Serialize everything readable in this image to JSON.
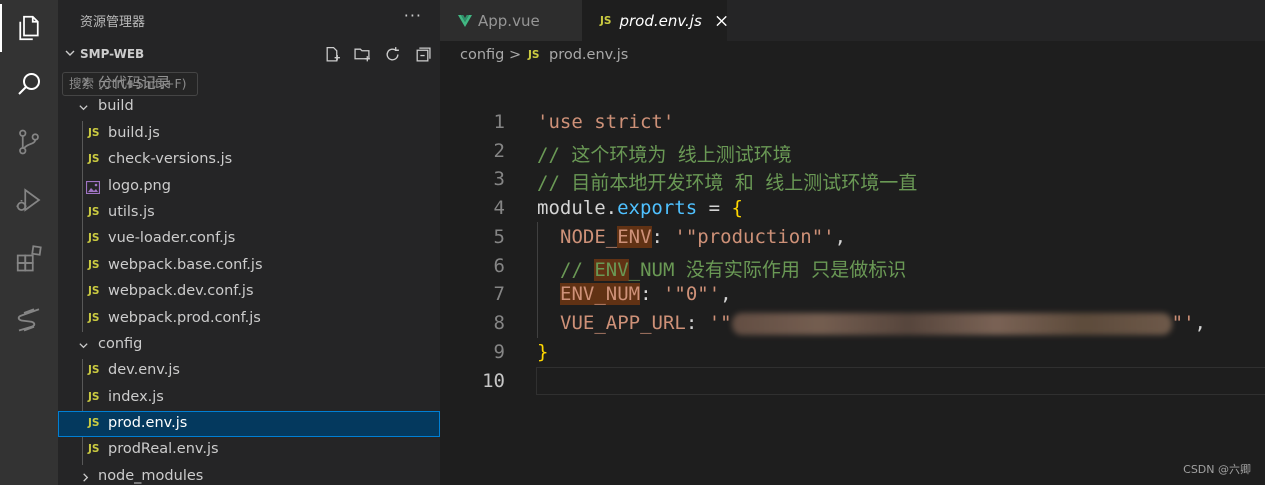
{
  "activity_bar": {
    "items": [
      {
        "icon": "explorer-icon",
        "active": true
      },
      {
        "icon": "search-icon"
      },
      {
        "icon": "source-control-icon"
      },
      {
        "icon": "run-debug-icon"
      },
      {
        "icon": "extensions-icon"
      },
      {
        "icon": "remote-s-icon"
      }
    ]
  },
  "sidebar": {
    "title": "资源管理器",
    "more": "···",
    "section": "SMP-WEB",
    "tooltip": "搜索 (Ctrl+Shift+F)",
    "tree": [
      {
        "label": "分代码记录",
        "type": "folder",
        "depth": 1,
        "expanded": false
      },
      {
        "label": "build",
        "type": "folder",
        "depth": 1,
        "expanded": true
      },
      {
        "label": "build.js",
        "type": "js",
        "depth": 2
      },
      {
        "label": "check-versions.js",
        "type": "js",
        "depth": 2
      },
      {
        "label": "logo.png",
        "type": "image",
        "depth": 2
      },
      {
        "label": "utils.js",
        "type": "js",
        "depth": 2
      },
      {
        "label": "vue-loader.conf.js",
        "type": "js",
        "depth": 2
      },
      {
        "label": "webpack.base.conf.js",
        "type": "js",
        "depth": 2
      },
      {
        "label": "webpack.dev.conf.js",
        "type": "js",
        "depth": 2
      },
      {
        "label": "webpack.prod.conf.js",
        "type": "js",
        "depth": 2
      },
      {
        "label": "config",
        "type": "folder",
        "depth": 1,
        "expanded": true
      },
      {
        "label": "dev.env.js",
        "type": "js",
        "depth": 2
      },
      {
        "label": "index.js",
        "type": "js",
        "depth": 2
      },
      {
        "label": "prod.env.js",
        "type": "js",
        "depth": 2,
        "selected": true
      },
      {
        "label": "prodReal.env.js",
        "type": "js",
        "depth": 2
      },
      {
        "label": "node_modules",
        "type": "folder",
        "depth": 1,
        "expanded": false
      }
    ],
    "js_badge": "JS"
  },
  "tabs": [
    {
      "label": "App.vue",
      "icon": "vue-icon",
      "active": false
    },
    {
      "label": "prod.env.js",
      "icon": "js-icon",
      "active": true,
      "badge": "JS"
    }
  ],
  "breadcrumb": {
    "folder": "config",
    "separator": ">",
    "file": "prod.env.js",
    "badge": "JS"
  },
  "editor": {
    "line_numbers": [
      "1",
      "2",
      "3",
      "4",
      "5",
      "6",
      "7",
      "8",
      "9",
      "10"
    ],
    "current_line": 10,
    "lines": {
      "l1": "'use strict'",
      "l2": "// 这个环境为 线上测试环境",
      "l3": "// 目前本地开发环境 和 线上测试环境一直",
      "l4_module": "module",
      "l4_dot": ".",
      "l4_exports": "exports",
      "l4_eq": " = ",
      "l4_brace": "{",
      "l5_key_a": "NODE_",
      "l5_key_b": "ENV",
      "l5_colon": ": ",
      "l5_val": "'\"production\"'",
      "l5_comma": ",",
      "l6_a": "// ",
      "l6_b": "ENV",
      "l6_c": "_NUM 没有实际作用 只是做标识",
      "l7_key": "ENV_NUM",
      "l7_colon": ": ",
      "l7_val": "'\"0\"'",
      "l7_comma": ",",
      "l8_key": "VUE_APP_URL",
      "l8_colon": ": ",
      "l8_val_open": "'\"",
      "l8_val_close": "\"'",
      "l8_comma": ",",
      "l9": "}"
    }
  },
  "watermark": "CSDN @六卿",
  "colors": {
    "activity_bg": "#333333",
    "sidebar_bg": "#252526",
    "editor_bg": "#1e1e1e",
    "selection": "#04395e",
    "selection_border": "#007fd4",
    "js_yellow": "#cbcb41",
    "string": "#ce9178",
    "comment": "#6a9955",
    "property": "#9cdcfe",
    "brace": "#ffd700"
  }
}
